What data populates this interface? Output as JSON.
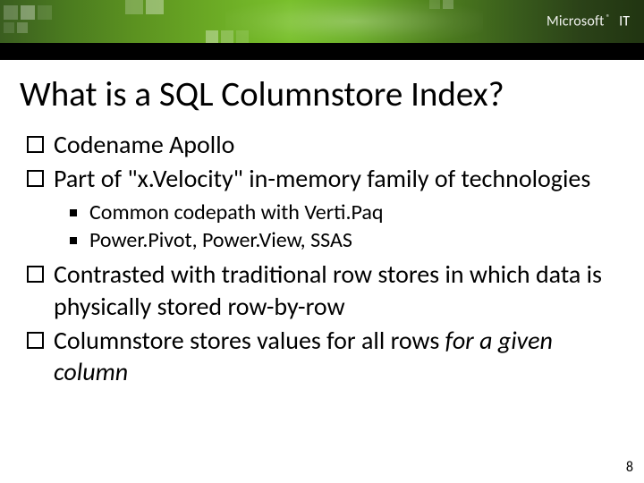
{
  "brand": {
    "company": "Microsoft",
    "mark": "®",
    "suffix": "IT"
  },
  "title": "What is a SQL Columnstore Index?",
  "bullets": {
    "l1_0": "Codename Apollo",
    "l1_1": "Part of \"x.Velocity\" in-memory family of technologies",
    "l2_0": "Common codepath with Verti.Paq",
    "l2_1": "Power.Pivot, Power.View, SSAS",
    "l1_2": "Contrasted with traditional row stores in which data is physically stored row-by-row",
    "l1_3_pre": "Columnstore stores values for all rows ",
    "l1_3_ital": "for a given column"
  },
  "page_number": "8"
}
